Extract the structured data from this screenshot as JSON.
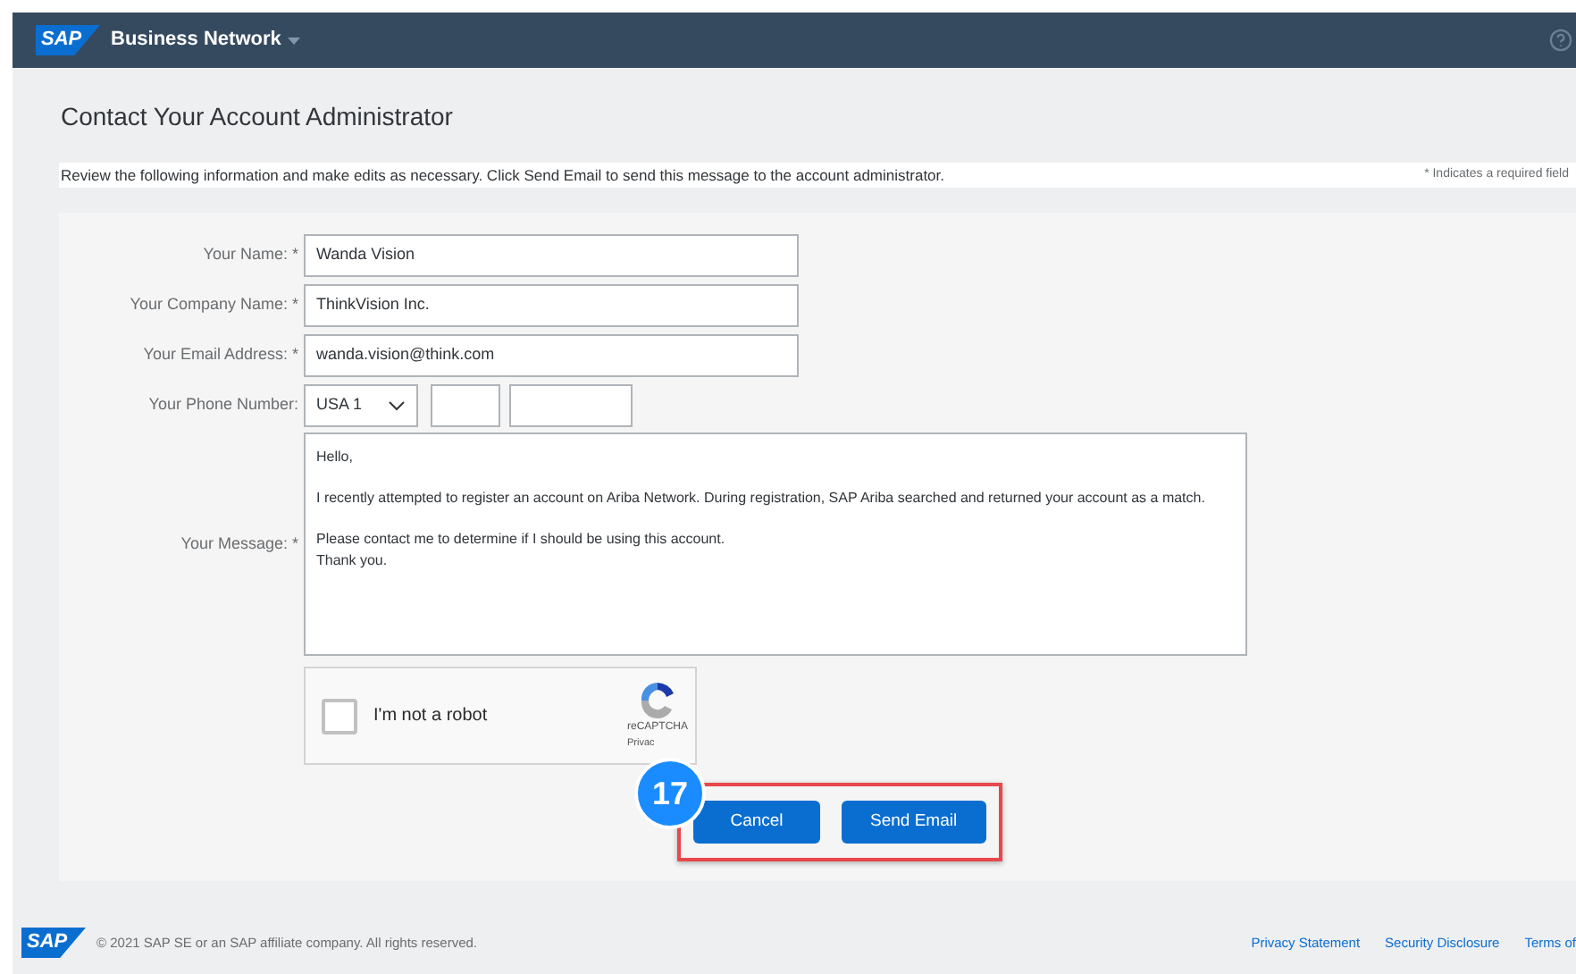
{
  "header": {
    "logo": "SAP",
    "title": "Business Network"
  },
  "page_title": "Contact Your Account Administrator",
  "instructions": "Review the following information and make edits as necessary. Click Send Email to send this message to the account administrator.",
  "required_note": "* Indicates a required field",
  "fields": [
    {
      "label": "Your Name: *",
      "value": "Wanda Vision"
    },
    {
      "label": "Your Company Name: *",
      "value": "ThinkVision Inc."
    },
    {
      "label": "Your Email Address: *",
      "value": "wanda.vision@think.com"
    }
  ],
  "phone": {
    "label": "Your Phone Number:",
    "country": "USA 1"
  },
  "message": {
    "label": "Your Message: *",
    "value": "Hello,\n\nI recently attempted to register an account on Ariba Network. During registration, SAP Ariba searched and returned your account as a match.\n\nPlease contact me to determine if I should be using this account.\nThank you."
  },
  "captcha": {
    "label": "I'm not a robot",
    "checked": false,
    "brand": "reCAPTCHA",
    "privacy": "Privac"
  },
  "step_badge": "17",
  "buttons": [
    "Cancel",
    "Send Email"
  ],
  "footer": {
    "logo": "SAP",
    "copyright": "© 2021 SAP SE or an SAP affiliate company. All rights reserved.",
    "links": [
      "Privacy Statement",
      "Security Disclosure",
      "Terms of"
    ]
  }
}
